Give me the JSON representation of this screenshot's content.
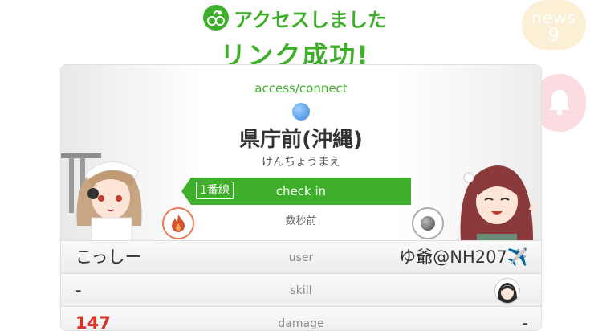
{
  "header": {
    "title_line1": "アクセスしました",
    "title_line2": "リンク成功!",
    "logo_icon": "app-logo-icon"
  },
  "news": {
    "label": "news",
    "count": "9"
  },
  "bell": {
    "icon": "bell-icon"
  },
  "card": {
    "access_label": "access/connect",
    "station_name": "県庁前(沖縄)",
    "station_kana": "けんちょうまえ",
    "line_badge": "1番線",
    "checkin_label": "check in",
    "time_ago": "数秒前",
    "left_attribute_icon": "fire-attribute-icon",
    "right_attribute_icon": "dark-attribute-icon"
  },
  "rows": [
    {
      "left": "こっしー",
      "center": "user",
      "right": "ゆ爺@NH207✈️"
    },
    {
      "left": "-",
      "center": "skill",
      "right": ""
    },
    {
      "left": "147",
      "center": "damage",
      "right": "-"
    }
  ],
  "colors": {
    "accent": "#3fae2a",
    "damage": "#d93025"
  }
}
